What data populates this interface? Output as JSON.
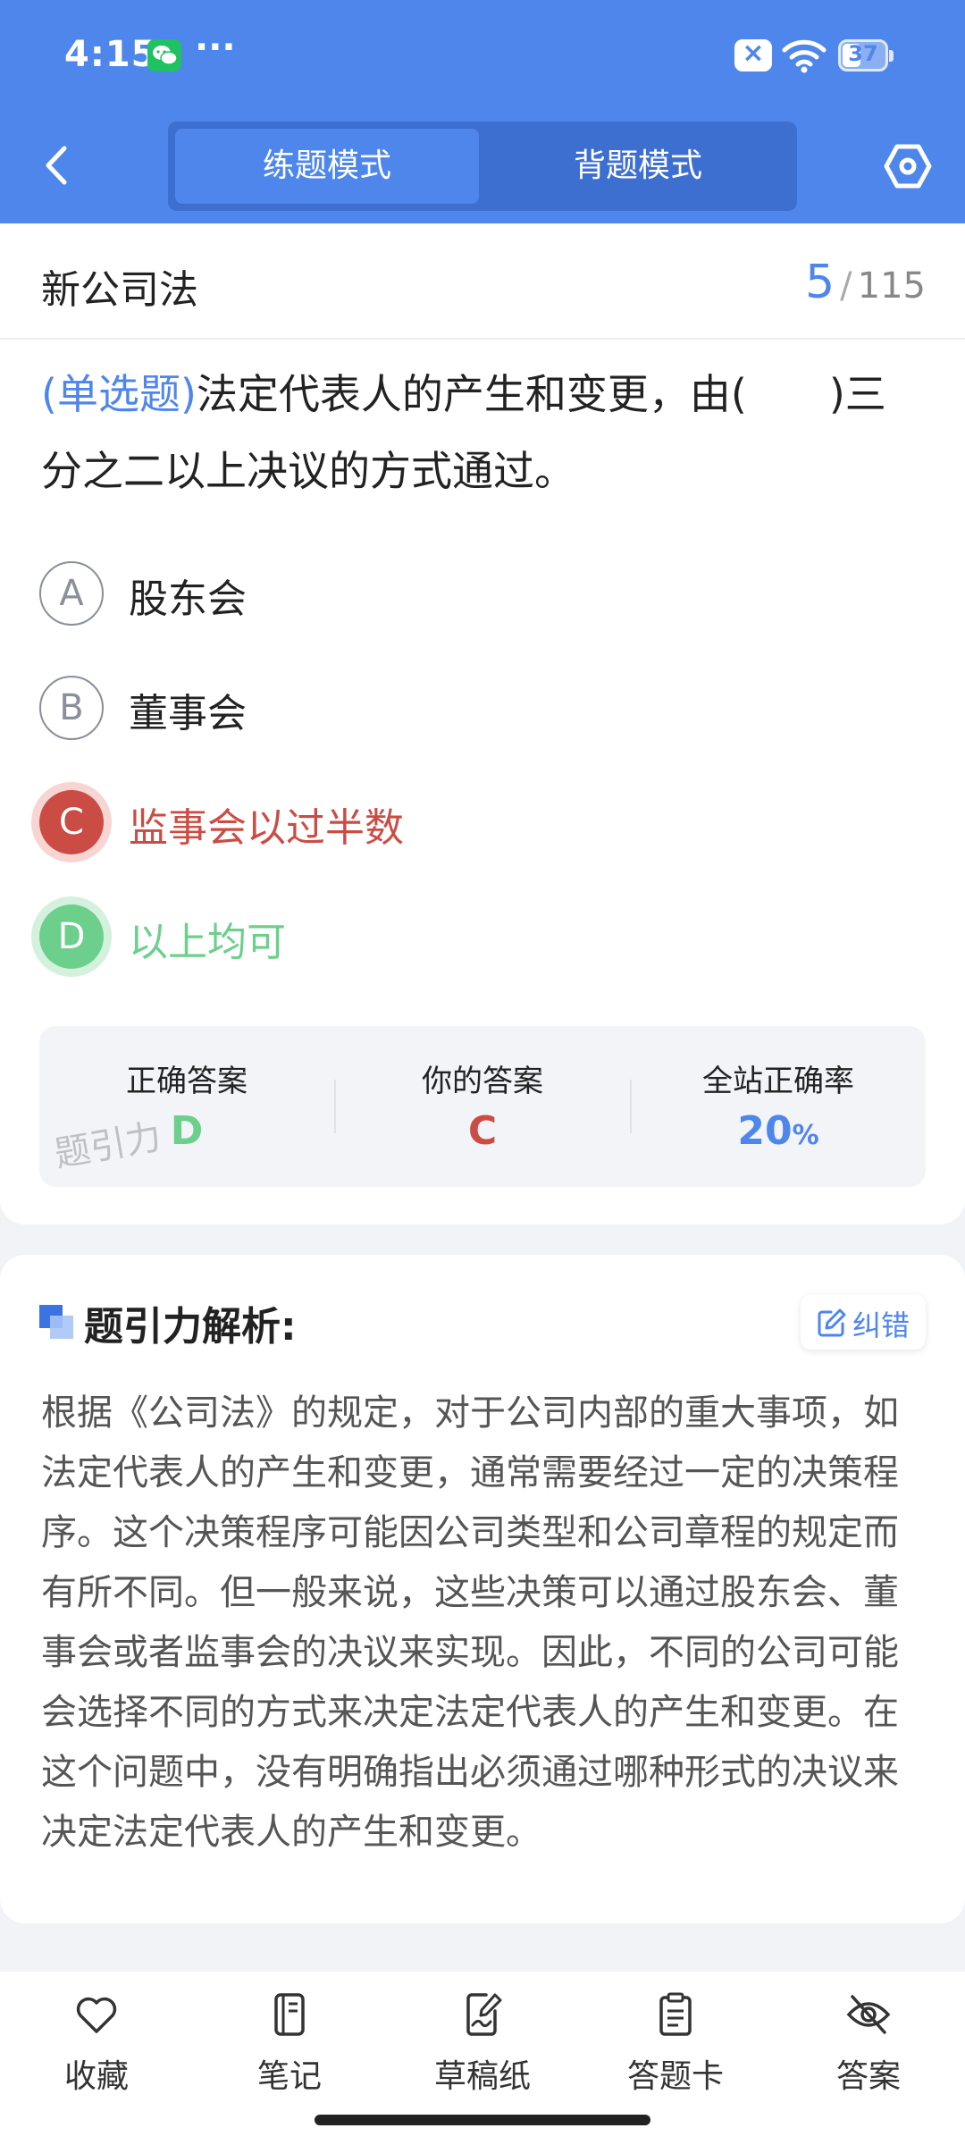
{
  "status_bar": {
    "time": "4:15",
    "dots": "···",
    "battery": "37"
  },
  "header": {
    "tabs": [
      {
        "label": "练题模式",
        "active": true
      },
      {
        "label": "背题模式",
        "active": false
      }
    ]
  },
  "question": {
    "subject": "新公司法",
    "current": "5",
    "separator": "/",
    "total": "115",
    "type_label": "(单选题)",
    "text": "法定代表人的产生和变更，由(　　)三分之二以上决议的方式通过。",
    "options": [
      {
        "letter": "A",
        "text": "股东会",
        "state": "normal"
      },
      {
        "letter": "B",
        "text": "董事会",
        "state": "normal"
      },
      {
        "letter": "C",
        "text": "监事会以过半数",
        "state": "wrong"
      },
      {
        "letter": "D",
        "text": "以上均可",
        "state": "correct"
      }
    ]
  },
  "answer_panel": {
    "correct_label": "正确答案",
    "correct_value": "D",
    "yours_label": "你的答案",
    "yours_value": "C",
    "rate_label": "全站正确率",
    "rate_value": "20",
    "rate_unit": "%",
    "watermark": "题引力"
  },
  "analysis": {
    "title": "题引力解析:",
    "correct_button": "纠错",
    "text": "根据《公司法》的规定，对于公司内部的重大事项，如法定代表人的产生和变更，通常需要经过一定的决策程序。这个决策程序可能因公司类型和公司章程的规定而有所不同。但一般来说，这些决策可以通过股东会、董事会或者监事会的决议来实现。因此，不同的公司可能会选择不同的方式来决定法定代表人的产生和变更。在这个问题中，没有明确指出必须通过哪种形式的决议来决定法定代表人的产生和变更。"
  },
  "bottom_nav": [
    {
      "label": "收藏",
      "icon": "heart-icon"
    },
    {
      "label": "笔记",
      "icon": "notebook-icon"
    },
    {
      "label": "草稿纸",
      "icon": "draft-paper-icon"
    },
    {
      "label": "答题卡",
      "icon": "answer-card-icon"
    },
    {
      "label": "答案",
      "icon": "eye-off-icon"
    }
  ],
  "colors": {
    "brand_blue": "#4e86ec",
    "wrong_red": "#cb4c44",
    "correct_green": "#6cd08c"
  }
}
